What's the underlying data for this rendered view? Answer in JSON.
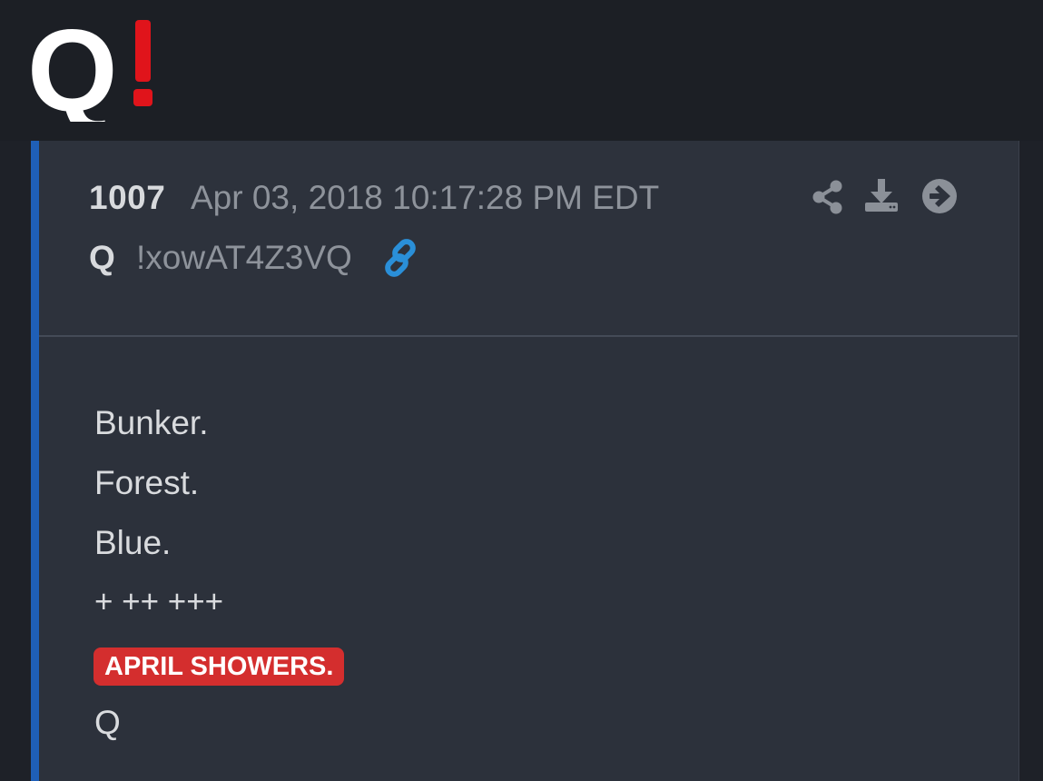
{
  "site": {
    "logo_text": "Q!",
    "logo_colors": {
      "q": "#ffffff",
      "exclaim": "#e0141b"
    }
  },
  "post": {
    "number": "1007",
    "date": "Apr 03, 2018 10:17:28 PM EDT",
    "author": "Q",
    "tripcode": "!xowAT4Z3VQ",
    "actions": [
      {
        "icon": "share-icon"
      },
      {
        "icon": "download-icon"
      },
      {
        "icon": "arrow-right-circle-icon"
      }
    ],
    "link_icon": "link-icon",
    "lines": [
      "Bunker.",
      "Forest.",
      "Blue.",
      "+ ++ +++"
    ],
    "highlight": "APRIL SHOWERS.",
    "signature": "Q"
  },
  "colors": {
    "accent_bar": "#1f5fb7",
    "badge": "#d42e2e",
    "link": "#2a8fd8"
  }
}
